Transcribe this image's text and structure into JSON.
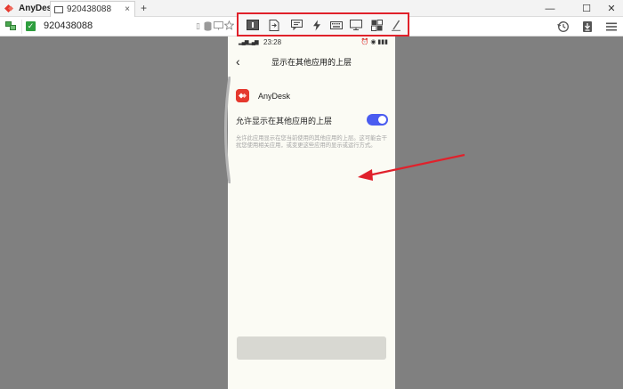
{
  "window": {
    "app_name": "AnyDesk",
    "tab_label": "920438088",
    "tab_close": "×",
    "new_tab": "+",
    "minimize": "—",
    "maximize": "☐",
    "close": "✕"
  },
  "address": {
    "id": "920438088",
    "check": "✓"
  },
  "phone": {
    "status_time": "23:28",
    "status_signal": "▂▄▆ ▂▄▆",
    "status_right": "⏰ ◉ ▮▮▮",
    "back": "‹",
    "title": "显示在其他应用的上层",
    "app_name": "AnyDesk",
    "permission_label": "允许显示在其他应用的上层",
    "toggle_on": true,
    "description": "允许此应用显示在您当前使用的其他应用的上层。这可能会干扰您使用相关应用，或变更这些应用的显示或运行方式。"
  },
  "colors": {
    "accent_red": "#e0212b",
    "anydesk_red": "#e5392e",
    "toggle_blue": "#4a5cf0",
    "background_gray": "#808080"
  },
  "icons": {
    "toolbar": [
      "display-one-icon",
      "file-transfer-icon",
      "chat-icon",
      "actions-bolt-icon",
      "keyboard-icon",
      "monitor-icon",
      "permissions-icon",
      "whiteboard-pen-icon"
    ],
    "right": [
      "history-icon",
      "download-icon",
      "menu-icon"
    ]
  }
}
